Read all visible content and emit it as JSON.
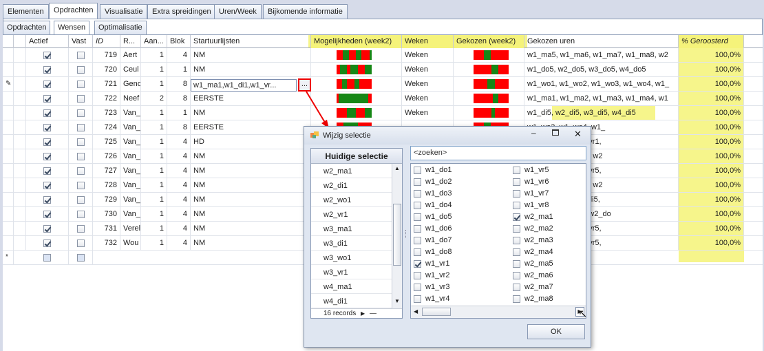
{
  "main_tabs": [
    "Elementen",
    "Opdrachten",
    "Visualisatie",
    "Extra spreidingen",
    "Uren/Week",
    "Bijkomende informatie"
  ],
  "sub_tabs": [
    "Opdrachten",
    "Wensen",
    "Optimalisatie"
  ],
  "columns": {
    "actief": "Actief",
    "vast": "Vast",
    "id": "ID",
    "r": "R...",
    "aan": "Aan...",
    "blok": "Blok",
    "start": "Startuurlijsten",
    "mog": "Mogelijkheden (week2)",
    "weken": "Weken",
    "gekozen": "Gekozen (week2)",
    "uren": "Gekozen uren",
    "pct": "% Geroosterd"
  },
  "rows": [
    {
      "id": "719",
      "r": "Aert",
      "aan": "1",
      "blok": "4",
      "start": "NM",
      "weken": "Weken",
      "uren": "w1_ma5, w1_ma6, w1_ma7, w1_ma8, w2",
      "pct": "100,0%"
    },
    {
      "id": "720",
      "r": "Ceul",
      "aan": "1",
      "blok": "1",
      "start": "NM",
      "weken": "Weken",
      "uren": "w1_do5, w2_do5, w3_do5, w4_do5",
      "pct": "100,0%"
    },
    {
      "id": "721",
      "r": "Geno",
      "aan": "1",
      "blok": "8",
      "start": "w1_ma1,w1_di1,w1_vr...",
      "weken": "Weken",
      "uren": "w1_wo1, w1_wo2, w1_wo3, w1_wo4, w1_",
      "pct": "100,0%"
    },
    {
      "id": "722",
      "r": "Neef",
      "aan": "2",
      "blok": "8",
      "start": "EERSTE",
      "weken": "Weken",
      "uren": "w1_ma1, w1_ma2, w1_ma3, w1_ma4, w1",
      "pct": "100,0%"
    },
    {
      "id": "723",
      "r": "Van_",
      "aan": "1",
      "blok": "1",
      "start": "NM",
      "weken": "Weken",
      "uren": "w1_di5, w2_di5, w3_di5, w4_di5",
      "pct": "100,0%"
    },
    {
      "id": "724",
      "r": "Van_",
      "aan": "1",
      "blok": "8",
      "start": "EERSTE",
      "weken": "",
      "uren": "w1_wo3, w1_wo4, w1_",
      "pct": "100,0%"
    },
    {
      "id": "725",
      "r": "Van_",
      "aan": "1",
      "blok": "4",
      "start": "HD",
      "weken": "",
      "uren": "_vr3, w1_vr4, w2_vr1,",
      "pct": "100,0%"
    },
    {
      "id": "726",
      "r": "Van_",
      "aan": "1",
      "blok": "4",
      "start": "NM",
      "weken": "",
      "uren": "w1_ma7, w1_ma8, w2",
      "pct": "100,0%"
    },
    {
      "id": "727",
      "r": "Van_",
      "aan": "1",
      "blok": "4",
      "start": "NM",
      "weken": "",
      "uren": "_vr7, w1_vr8, w2_vr5,",
      "pct": "100,0%"
    },
    {
      "id": "728",
      "r": "Van_",
      "aan": "1",
      "blok": "4",
      "start": "NM",
      "weken": "",
      "uren": "w1_ma7, w1_ma8, w2",
      "pct": "100,0%"
    },
    {
      "id": "729",
      "r": "Van_",
      "aan": "1",
      "blok": "4",
      "start": "NM",
      "weken": "",
      "uren": "_di7, w1_di8, w2_di5,",
      "pct": "100,0%"
    },
    {
      "id": "730",
      "r": "Van_",
      "aan": "1",
      "blok": "4",
      "start": "NM",
      "weken": "",
      "uren": "w1_do7, w1_do8, w2_do",
      "pct": "100,0%"
    },
    {
      "id": "731",
      "r": "Verel",
      "aan": "1",
      "blok": "4",
      "start": "NM",
      "weken": "",
      "uren": "_vr7, w1_vr8, w2_vr5,",
      "pct": "100,0%"
    },
    {
      "id": "732",
      "r": "Wou",
      "aan": "1",
      "blok": "4",
      "start": "NM",
      "weken": "",
      "uren": "_vr7, w1_vr8, w2_vr5,",
      "pct": "100,0%"
    }
  ],
  "mog_fractions": [
    [
      0.18,
      0.35,
      0.55,
      0.7,
      0.95
    ],
    [
      0.1,
      0.3,
      0.4,
      0.6,
      0.8
    ],
    [
      0.15,
      0.3,
      0.5,
      0.65
    ],
    [
      0.05,
      0.9
    ],
    [
      0.3,
      0.55,
      0.8
    ],
    [
      0.2,
      0.6
    ]
  ],
  "gek_fractions": [
    [
      0.3,
      0.5
    ],
    [
      0.5,
      0.7
    ],
    [
      0.4,
      0.6
    ],
    [
      0.55,
      0.7
    ],
    [
      0.5,
      0.6
    ]
  ],
  "edit_button_label": "...",
  "dialog": {
    "title": "Wijzig selectie",
    "left_header": "Huidige selectie",
    "current": [
      "w2_ma1",
      "w2_di1",
      "w2_wo1",
      "w2_vr1",
      "w3_ma1",
      "w3_di1",
      "w3_wo1",
      "w3_vr1",
      "w4_ma1",
      "w4_di1"
    ],
    "records": "16 records",
    "search_placeholder": "<zoeken>",
    "col1": [
      {
        "l": "w1_do1",
        "c": false
      },
      {
        "l": "w1_do2",
        "c": false
      },
      {
        "l": "w1_do3",
        "c": false
      },
      {
        "l": "w1_do4",
        "c": false
      },
      {
        "l": "w1_do5",
        "c": false
      },
      {
        "l": "w1_do6",
        "c": false
      },
      {
        "l": "w1_do7",
        "c": false
      },
      {
        "l": "w1_do8",
        "c": false
      },
      {
        "l": "w1_vr1",
        "c": true
      },
      {
        "l": "w1_vr2",
        "c": false
      },
      {
        "l": "w1_vr3",
        "c": false
      },
      {
        "l": "w1_vr4",
        "c": false
      }
    ],
    "col2": [
      {
        "l": "w1_vr5",
        "c": false
      },
      {
        "l": "w1_vr6",
        "c": false
      },
      {
        "l": "w1_vr7",
        "c": false
      },
      {
        "l": "w1_vr8",
        "c": false
      },
      {
        "l": "w2_ma1",
        "c": true
      },
      {
        "l": "w2_ma2",
        "c": false
      },
      {
        "l": "w2_ma3",
        "c": false
      },
      {
        "l": "w2_ma4",
        "c": false
      },
      {
        "l": "w2_ma5",
        "c": false
      },
      {
        "l": "w2_ma6",
        "c": false
      },
      {
        "l": "w2_ma7",
        "c": false
      },
      {
        "l": "w2_ma8",
        "c": false
      }
    ],
    "ok": "OK"
  },
  "colors": {
    "bar_red": "#ff0000",
    "bar_green": "#168716",
    "highlight": "#f6f58b"
  }
}
